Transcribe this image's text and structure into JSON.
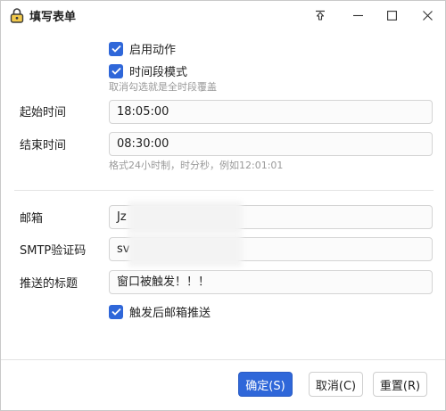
{
  "window": {
    "title": "填写表单",
    "icons": [
      "lock-icon",
      "pin-icon",
      "minimize-icon",
      "maximize-icon",
      "close-icon"
    ]
  },
  "options": {
    "enable_action": {
      "label": "启用动作",
      "checked": true
    },
    "time_mode": {
      "label": "时间段模式",
      "checked": true,
      "hint": "取消勾选就是全时段覆盖"
    }
  },
  "time": {
    "start_label": "起始时间",
    "start_value": "18:05:00",
    "end_label": "结束时间",
    "end_value": "08:30:00",
    "hint": "格式24小时制，时分秒，例如12:01:01"
  },
  "mail": {
    "email_label": "邮箱",
    "email_value": "Jz",
    "smtp_label": "SMTP验证码",
    "smtp_value": "sv",
    "subject_label": "推送的标题",
    "subject_value": "窗口被触发！！！",
    "push_after": {
      "label": "触发后邮箱推送",
      "checked": true
    }
  },
  "buttons": {
    "ok": "确定(S)",
    "cancel": "取消(C)",
    "reset": "重置(R)"
  },
  "colors": {
    "accent": "#2f67d9",
    "hint": "#9a9a9a",
    "border": "#d4d4d4"
  }
}
